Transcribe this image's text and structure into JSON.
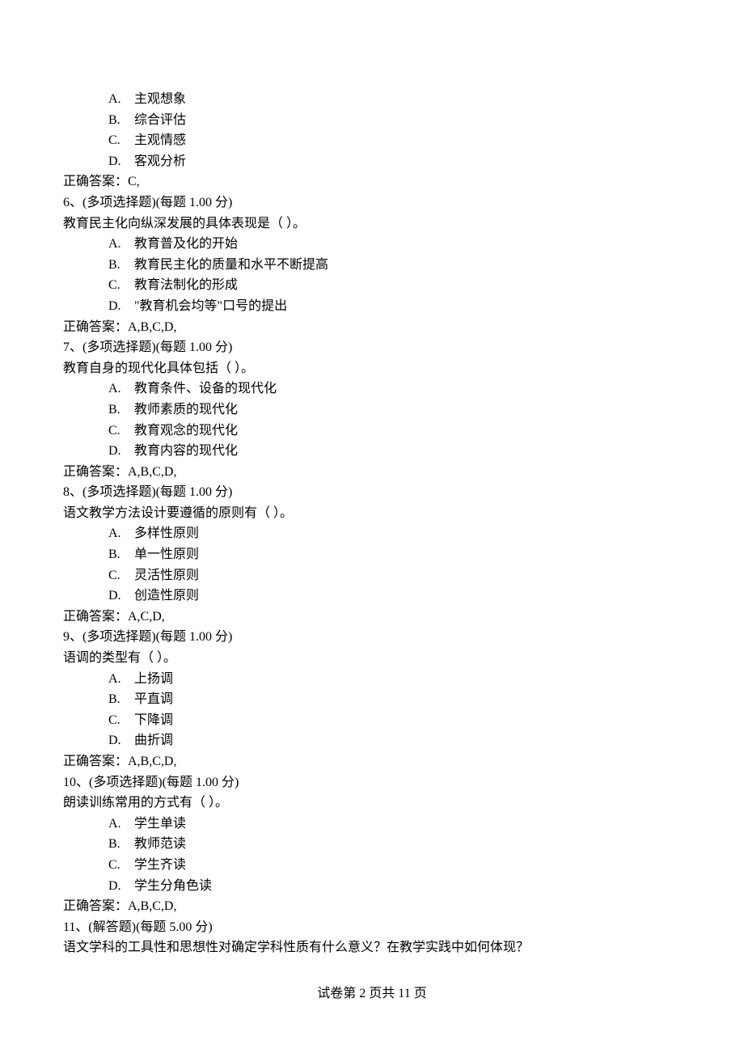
{
  "q5_tail": {
    "options": [
      {
        "label": "A.",
        "text": "主观想象"
      },
      {
        "label": "B.",
        "text": "综合评估"
      },
      {
        "label": "C.",
        "text": "主观情感"
      },
      {
        "label": "D.",
        "text": "客观分析"
      }
    ],
    "answer": "正确答案：C,"
  },
  "questions": [
    {
      "header": "6、(多项选择题)(每题 1.00 分)",
      "stem": "教育民主化向纵深发展的具体表现是（  ）。",
      "options": [
        {
          "label": "A.",
          "text": "教育普及化的开始"
        },
        {
          "label": "B.",
          "text": "教育民主化的质量和水平不断提高"
        },
        {
          "label": "C.",
          "text": "教育法制化的形成"
        },
        {
          "label": "D.",
          "text": " \"教育机会均等\"口号的提出"
        }
      ],
      "answer": "正确答案：A,B,C,D,"
    },
    {
      "header": "7、(多项选择题)(每题 1.00 分)",
      "stem": "教育自身的现代化具体包括（  ）。",
      "options": [
        {
          "label": "A.",
          "text": "教育条件、设备的现代化"
        },
        {
          "label": "B.",
          "text": "教师素质的现代化"
        },
        {
          "label": "C.",
          "text": "教育观念的现代化"
        },
        {
          "label": "D.",
          "text": "教育内容的现代化"
        }
      ],
      "answer": "正确答案：A,B,C,D,"
    },
    {
      "header": "8、(多项选择题)(每题 1.00 分)",
      "stem": "语文教学方法设计要遵循的原则有（  ）。",
      "options": [
        {
          "label": "A.",
          "text": "多样性原则"
        },
        {
          "label": "B.",
          "text": "单一性原则"
        },
        {
          "label": "C.",
          "text": "灵活性原则"
        },
        {
          "label": "D.",
          "text": "创造性原则"
        }
      ],
      "answer": "正确答案：A,C,D,"
    },
    {
      "header": "9、(多项选择题)(每题 1.00 分)",
      "stem": "语调的类型有（  ）。",
      "options": [
        {
          "label": "A.",
          "text": "上扬调"
        },
        {
          "label": "B.",
          "text": "平直调"
        },
        {
          "label": "C.",
          "text": "下降调"
        },
        {
          "label": "D.",
          "text": "曲折调"
        }
      ],
      "answer": "正确答案：A,B,C,D,"
    },
    {
      "header": "10、(多项选择题)(每题 1.00 分)",
      "stem": "朗读训练常用的方式有（  ）。",
      "options": [
        {
          "label": "A.",
          "text": "学生单读"
        },
        {
          "label": "B.",
          "text": "教师范读"
        },
        {
          "label": "C.",
          "text": "学生齐读"
        },
        {
          "label": "D.",
          "text": "学生分角色读"
        }
      ],
      "answer": "正确答案：A,B,C,D,"
    },
    {
      "header": "11、(解答题)(每题 5.00 分)",
      "stem": "语文学科的工具性和思想性对确定学科性质有什么意义？在教学实践中如何体现？",
      "options": [],
      "answer": ""
    }
  ],
  "footer": "试卷第 2 页共 11 页"
}
